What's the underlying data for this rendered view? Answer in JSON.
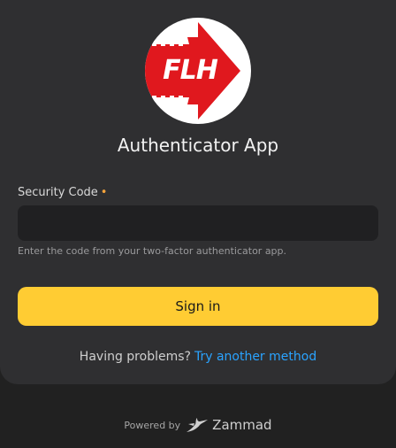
{
  "logo": {
    "text": "FLH",
    "colors": {
      "red": "#e0181e",
      "white": "#ffffff"
    }
  },
  "title": "Authenticator App",
  "form": {
    "label": "Security Code",
    "required_marker": "•",
    "input_value": "",
    "help_text": "Enter the code from your two-factor authenticator app.",
    "submit_label": "Sign in"
  },
  "problems": {
    "question": "Having problems?",
    "link_label": "Try another method"
  },
  "footer": {
    "powered_by": "Powered by",
    "brand": "Zammad",
    "icon": "zammad-bird-icon"
  },
  "colors": {
    "page_bg": "#212121",
    "card_bg": "#2f2f31",
    "accent": "#ffcc33",
    "link": "#2aa3ff",
    "required": "#f5a33b"
  }
}
